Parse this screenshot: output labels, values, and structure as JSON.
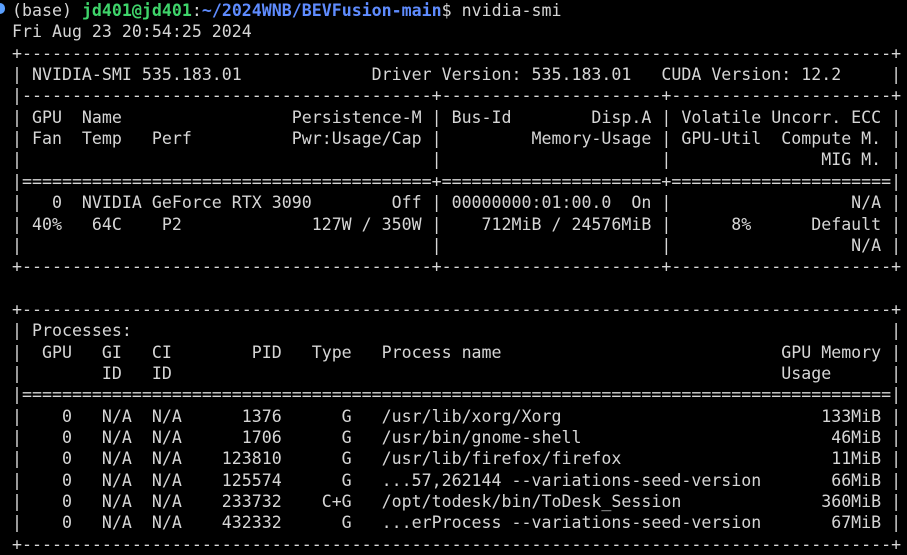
{
  "prompt": {
    "env": "(base) ",
    "user_host": "jd401@jd401",
    "colon": ":",
    "path": "~/2024WNB/BEVFusion-main",
    "sigil": "$ ",
    "command": "nvidia-smi"
  },
  "output_lines": [
    "Fri Aug 23 20:54:25 2024",
    "+---------------------------------------------------------------------------------------+",
    "| NVIDIA-SMI 535.183.01             Driver Version: 535.183.01   CUDA Version: 12.2     |",
    "|-----------------------------------------+----------------------+----------------------+",
    "| GPU  Name                 Persistence-M | Bus-Id        Disp.A | Volatile Uncorr. ECC |",
    "| Fan  Temp   Perf          Pwr:Usage/Cap |         Memory-Usage | GPU-Util  Compute M. |",
    "|                                         |                      |               MIG M. |",
    "|=========================================+======================+======================|",
    "|   0  NVIDIA GeForce RTX 3090        Off | 00000000:01:00.0  On |                  N/A |",
    "| 40%   64C    P2             127W / 350W |    712MiB / 24576MiB |      8%      Default |",
    "|                                         |                      |                  N/A |",
    "+-----------------------------------------+----------------------+----------------------+",
    "",
    "+---------------------------------------------------------------------------------------+",
    "| Processes:                                                                            |",
    "|  GPU   GI   CI        PID   Type   Process name                            GPU Memory |",
    "|        ID   ID                                                             Usage      |",
    "|=======================================================================================|",
    "|    0   N/A  N/A      1376      G   /usr/lib/xorg/Xorg                          133MiB |",
    "|    0   N/A  N/A      1706      G   /usr/bin/gnome-shell                         46MiB |",
    "|    0   N/A  N/A    123810      G   /usr/lib/firefox/firefox                     11MiB |",
    "|    0   N/A  N/A    125574      G   ...57,262144 --variations-seed-version       66MiB |",
    "|    0   N/A  N/A    233732    C+G   /opt/todesk/bin/ToDesk_Session              360MiB |",
    "|    0   N/A  N/A    432332      G   ...erProcess --variations-seed-version       67MiB |",
    "+---------------------------------------------------------------------------------------+"
  ]
}
